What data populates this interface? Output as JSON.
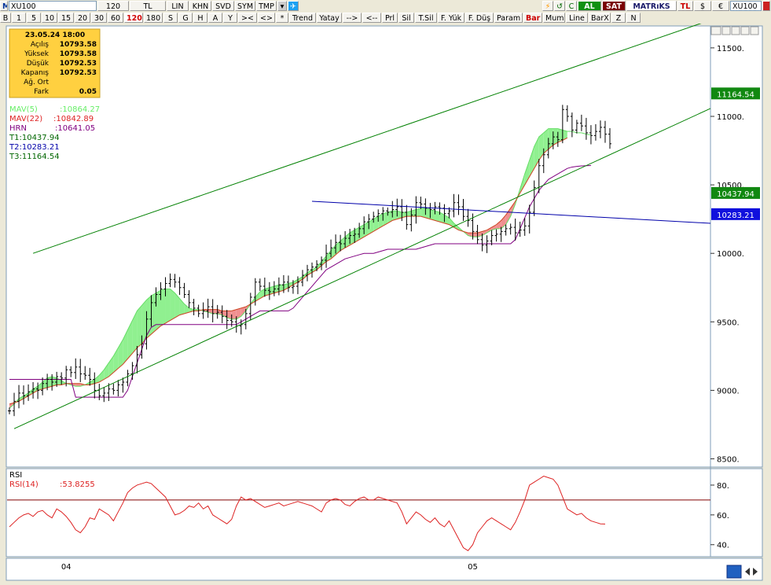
{
  "toolbar1": {
    "logo": "M",
    "symbol": "XU100",
    "items": [
      {
        "id": "interval",
        "label": "120",
        "w": 40
      },
      {
        "id": "currency",
        "label": "TL",
        "w": 46
      },
      {
        "id": "lin",
        "label": "LIN",
        "w": 28
      },
      {
        "id": "khn",
        "label": "KHN",
        "w": 28
      },
      {
        "id": "svd",
        "label": "SVD",
        "w": 28
      },
      {
        "id": "sym",
        "label": "SYM",
        "w": 26
      },
      {
        "id": "tmp",
        "label": "TMP",
        "w": 26
      }
    ],
    "right_icons": [
      "⚡",
      "↺",
      "C"
    ],
    "al_label": "AL",
    "sat_label": "SAT",
    "brand": "MATRıKS",
    "tl_label": "TL",
    "usd_label": "$",
    "eur_label": "€",
    "symbol2": "XU100"
  },
  "toolbar2": {
    "items": [
      {
        "id": "b",
        "label": "B",
        "w": 14
      },
      {
        "id": "p1",
        "label": "1",
        "w": 18
      },
      {
        "id": "p5",
        "label": "5",
        "w": 18
      },
      {
        "id": "p10",
        "label": "10",
        "w": 20
      },
      {
        "id": "p15",
        "label": "15",
        "w": 20
      },
      {
        "id": "p20",
        "label": "20",
        "w": 20
      },
      {
        "id": "p30",
        "label": "30",
        "w": 20
      },
      {
        "id": "p60",
        "label": "60",
        "w": 20
      },
      {
        "id": "p120",
        "label": "120",
        "w": 24,
        "selected": true
      },
      {
        "id": "p180",
        "label": "180",
        "w": 24
      },
      {
        "id": "s",
        "label": "S",
        "w": 18
      },
      {
        "id": "g",
        "label": "G",
        "w": 18
      },
      {
        "id": "h",
        "label": "H",
        "w": 18
      },
      {
        "id": "a",
        "label": "A",
        "w": 18
      },
      {
        "id": "y",
        "label": "Y",
        "w": 18
      },
      {
        "id": "lt",
        "label": "><",
        "w": 24
      },
      {
        "id": "gt",
        "label": "<>",
        "w": 22
      },
      {
        "id": "star",
        "label": "*",
        "w": 16
      },
      {
        "id": "trend",
        "label": "Trend",
        "w": 34
      },
      {
        "id": "yatay",
        "label": "Yatay",
        "w": 32
      },
      {
        "id": "arr1",
        "label": "-->",
        "w": 24
      },
      {
        "id": "arr2",
        "label": "<--",
        "w": 24
      },
      {
        "id": "prl",
        "label": "Prl",
        "w": 20
      },
      {
        "id": "sil",
        "label": "Sil",
        "w": 20
      },
      {
        "id": "tsil",
        "label": "T.Sil",
        "w": 28
      },
      {
        "id": "fyuk",
        "label": "F. Yük",
        "w": 34
      },
      {
        "id": "fdus",
        "label": "F. Düş",
        "w": 36
      },
      {
        "id": "param",
        "label": "Param",
        "w": 36
      },
      {
        "id": "bar",
        "label": "Bar",
        "w": 24,
        "red": true
      },
      {
        "id": "mum",
        "label": "Mum",
        "w": 28
      },
      {
        "id": "line",
        "label": "Line",
        "w": 28
      },
      {
        "id": "barx",
        "label": "BarX",
        "w": 28
      },
      {
        "id": "z",
        "label": "Z",
        "w": 18
      },
      {
        "id": "n",
        "label": "N",
        "w": 18
      }
    ]
  },
  "info_box": {
    "datetime": "23.05.24 18:00",
    "rows": [
      {
        "label": "Açılış",
        "value": "10793.58"
      },
      {
        "label": "Yüksek",
        "value": "10793.58"
      },
      {
        "label": "Düşük",
        "value": "10792.53"
      },
      {
        "label": "Kapanış",
        "value": "10792.53"
      },
      {
        "label": "Ağ. Ort",
        "value": ""
      },
      {
        "label": "Fark",
        "value": "0.05"
      }
    ]
  },
  "legend": [
    {
      "label": "MAV(5)",
      "value": ":10864.27",
      "color": "#66ee66"
    },
    {
      "label": "MAV(22)",
      "value": ":10842.89",
      "color": "#dd2222"
    },
    {
      "label": "HRN",
      "value": ":10641.05",
      "color": "#800080"
    },
    {
      "label": "T1:10437.94",
      "value": "",
      "color": "#006600"
    },
    {
      "label": "T2:10283.21",
      "value": "",
      "color": "#0000aa"
    },
    {
      "label": "T3:11164.54",
      "value": "",
      "color": "#006600"
    }
  ],
  "colors": {
    "bull_fill": "#90f090",
    "bear_fill": "#f09090",
    "mav_fast": "#66dd66",
    "mav_slow": "#cc4422",
    "hrn": "#800080",
    "channel": "#008000",
    "trendline": "#0000aa",
    "rsi": "#dd2222"
  },
  "chart_data": {
    "type": "bar",
    "title": "",
    "ylim": [
      8440,
      11660
    ],
    "y_ticks": [
      8500,
      9000,
      9500,
      10000,
      10500,
      11000,
      11500
    ],
    "y_tick_labels": [
      "8500.",
      "9000.",
      "9500.",
      "10000.",
      "10500.",
      "11000.",
      "11500."
    ],
    "x_tick_labels": [
      {
        "label": "04",
        "bar": 12
      },
      {
        "label": "05",
        "bar": 98
      }
    ],
    "price_tags": [
      {
        "label": "11164.54",
        "value": 11164.54,
        "color": "#118811"
      },
      {
        "label": "10437.94",
        "value": 10437.94,
        "color": "#118811"
      },
      {
        "label": "10283.21",
        "value": 10283.21,
        "color": "#1010dd"
      }
    ],
    "close": [
      8850,
      8920,
      8980,
      8960,
      8990,
      9010,
      9000,
      9050,
      9080,
      9060,
      9100,
      9090,
      9150,
      9130,
      9170,
      9120,
      9110,
      9080,
      9000,
      8960,
      8980,
      9010,
      9000,
      9040,
      9060,
      9120,
      9180,
      9260,
      9340,
      9520,
      9640,
      9700,
      9740,
      9780,
      9810,
      9790,
      9750,
      9700,
      9640,
      9600,
      9560,
      9580,
      9610,
      9560,
      9570,
      9540,
      9510,
      9500,
      9470,
      9480,
      9560,
      9680,
      9790,
      9760,
      9730,
      9720,
      9740,
      9770,
      9790,
      9750,
      9760,
      9790,
      9840,
      9880,
      9900,
      9920,
      9950,
      10000,
      10040,
      10080,
      10070,
      10110,
      10130,
      10140,
      10180,
      10230,
      10250,
      10270,
      10290,
      10310,
      10300,
      10320,
      10340,
      10300,
      10210,
      10280,
      10370,
      10360,
      10330,
      10320,
      10340,
      10330,
      10290,
      10310,
      10370,
      10340,
      10270,
      10240,
      10160,
      10100,
      10060,
      10090,
      10130,
      10140,
      10160,
      10180,
      10190,
      10150,
      10170,
      10200,
      10300,
      10480,
      10640,
      10720,
      10800,
      10850,
      10830,
      11050,
      11000,
      10900,
      10950,
      10930,
      10880,
      10860,
      10890,
      10920,
      10870,
      10800
    ],
    "mav5": [
      8870,
      8900,
      8940,
      8960,
      8980,
      9010,
      9030,
      9060,
      9090,
      9100,
      9090,
      9070,
      9050,
      9040,
      9030,
      9030,
      9040,
      9060,
      9080,
      9110,
      9150,
      9200,
      9250,
      9310,
      9370,
      9440,
      9510,
      9580,
      9620,
      9660,
      9690,
      9710,
      9730,
      9740,
      9740,
      9710,
      9670,
      9630,
      9600,
      9590,
      9590,
      9580,
      9570,
      9560,
      9560,
      9550,
      9530,
      9520,
      9520,
      9540,
      9580,
      9630,
      9680,
      9720,
      9740,
      9750,
      9760,
      9770,
      9770,
      9780,
      9790,
      9810,
      9830,
      9860,
      9880,
      9900,
      9940,
      9980,
      10020,
      10060,
      10090,
      10120,
      10150,
      10170,
      10190,
      10210,
      10230,
      10250,
      10270,
      10290,
      10300,
      10310,
      10310,
      10300,
      10300,
      10310,
      10320,
      10330,
      10330,
      10320,
      10310,
      10300,
      10280,
      10260,
      10220,
      10190,
      10160,
      10130,
      10120,
      10120,
      10130,
      10150,
      10170,
      10180,
      10180,
      10210,
      10270,
      10360,
      10470,
      10580,
      10680,
      10780,
      10850,
      10880,
      10910,
      10910,
      10910,
      10900,
      10890,
      10890,
      10880,
      10880,
      10870,
      10864.27
    ],
    "mav22": [
      8900,
      8910,
      8920,
      8940,
      8960,
      8980,
      9000,
      9010,
      9020,
      9030,
      9040,
      9040,
      9050,
      9050,
      9050,
      9050,
      9040,
      9040,
      9050,
      9060,
      9080,
      9100,
      9130,
      9160,
      9190,
      9230,
      9270,
      9310,
      9340,
      9380,
      9410,
      9440,
      9470,
      9490,
      9510,
      9530,
      9550,
      9560,
      9570,
      9580,
      9580,
      9590,
      9590,
      9590,
      9590,
      9580,
      9580,
      9580,
      9590,
      9600,
      9610,
      9630,
      9650,
      9670,
      9690,
      9700,
      9710,
      9720,
      9730,
      9750,
      9770,
      9790,
      9810,
      9840,
      9860,
      9880,
      9910,
      9940,
      9960,
      9990,
      10020,
      10040,
      10060,
      10080,
      10100,
      10120,
      10140,
      10160,
      10180,
      10200,
      10220,
      10240,
      10250,
      10260,
      10270,
      10270,
      10270,
      10270,
      10260,
      10250,
      10240,
      10230,
      10220,
      10210,
      10190,
      10170,
      10160,
      10150,
      10150,
      10150,
      10160,
      10170,
      10190,
      10210,
      10240,
      10280,
      10330,
      10380,
      10440,
      10500,
      10560,
      10620,
      10680,
      10730,
      10760,
      10790,
      10810,
      10825,
      10842.89
    ],
    "hrn": [
      9080,
      9080,
      9080,
      9080,
      9080,
      9080,
      9080,
      9080,
      9080,
      9080,
      9080,
      9080,
      9080,
      9080,
      8950,
      8950,
      8950,
      8950,
      8950,
      8950,
      8950,
      8950,
      8950,
      8950,
      8950,
      9000,
      9100,
      9200,
      9300,
      9400,
      9460,
      9480,
      9480,
      9480,
      9480,
      9480,
      9480,
      9480,
      9480,
      9480,
      9480,
      9480,
      9480,
      9480,
      9480,
      9480,
      9480,
      9480,
      9480,
      9500,
      9520,
      9540,
      9560,
      9580,
      9580,
      9580,
      9580,
      9580,
      9580,
      9580,
      9600,
      9640,
      9680,
      9720,
      9760,
      9800,
      9840,
      9880,
      9900,
      9920,
      9940,
      9960,
      9970,
      9980,
      9990,
      10000,
      10000,
      10000,
      10010,
      10020,
      10030,
      10030,
      10030,
      10030,
      10030,
      10030,
      10030,
      10040,
      10050,
      10060,
      10070,
      10070,
      10070,
      10070,
      10070,
      10070,
      10070,
      10070,
      10070,
      10070,
      10070,
      10070,
      10070,
      10070,
      10070,
      10070,
      10070,
      10100,
      10180,
      10260,
      10340,
      10400,
      10460,
      10500,
      10540,
      10560,
      10580,
      10600,
      10620,
      10630,
      10635,
      10638,
      10640,
      10641.05
    ],
    "channel_upper": [
      {
        "bar": 5,
        "v": 10000
      },
      {
        "bar": 127,
        "v": 11450
      }
    ],
    "channel_lower": [
      {
        "bar": 1,
        "v": 8720
      },
      {
        "bar": 127,
        "v": 10720
      }
    ],
    "trendline": [
      {
        "bar": 64,
        "v": 10380
      },
      {
        "bar": 127,
        "v": 10260
      }
    ],
    "rsi": {
      "label": "RSI",
      "name": "RSI(14)",
      "value": ":53.8255",
      "level": 70,
      "ylim": [
        33,
        90
      ],
      "ticks": [
        40,
        60,
        80
      ],
      "tick_labels": [
        "40.",
        "60.",
        "80."
      ],
      "values": [
        52,
        55,
        58,
        60,
        61,
        59,
        62,
        63,
        60,
        58,
        64,
        62,
        59,
        55,
        50,
        48,
        52,
        58,
        57,
        64,
        62,
        60,
        56,
        62,
        68,
        75,
        78,
        80,
        81,
        82,
        81,
        78,
        75,
        72,
        66,
        60,
        61,
        63,
        66,
        65,
        68,
        64,
        66,
        60,
        58,
        56,
        54,
        57,
        66,
        72,
        70,
        71,
        69,
        67,
        65,
        66,
        67,
        68,
        66,
        67,
        68,
        69,
        68,
        67,
        66,
        64,
        62,
        68,
        70,
        71,
        70,
        67,
        66,
        69,
        71,
        72,
        70,
        70,
        72,
        71,
        70,
        69,
        68,
        62,
        54,
        58,
        62,
        60,
        57,
        55,
        58,
        54,
        52,
        56,
        50,
        44,
        38,
        36,
        40,
        48,
        52,
        56,
        58,
        56,
        54,
        52,
        50,
        55,
        62,
        70,
        80,
        82,
        84,
        86,
        85,
        84,
        80,
        72,
        64,
        62,
        60,
        61,
        58,
        56,
        55,
        54,
        53.8255
      ]
    }
  }
}
